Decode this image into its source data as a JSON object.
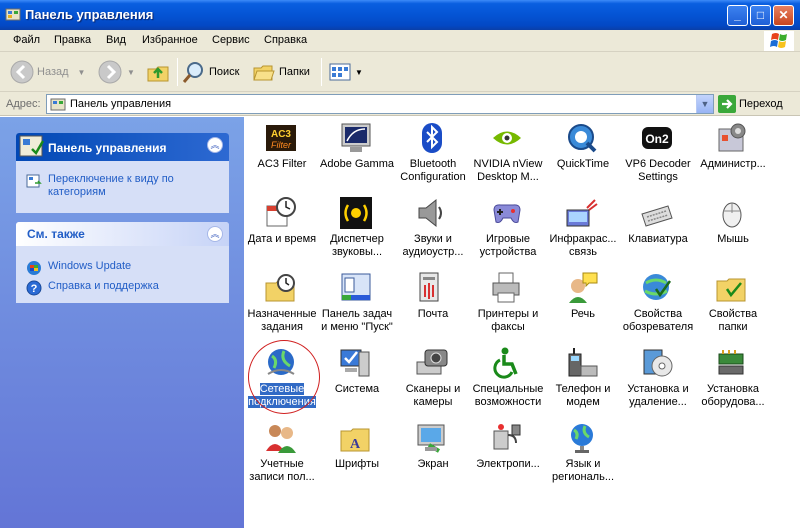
{
  "window": {
    "title": "Панель управления"
  },
  "menu": [
    "Файл",
    "Правка",
    "Вид",
    "Избранное",
    "Сервис",
    "Справка"
  ],
  "toolbar": {
    "back": "Назад",
    "search": "Поиск",
    "folders": "Папки"
  },
  "address": {
    "label": "Адрес:",
    "value": "Панель управления",
    "go": "Переход"
  },
  "sidebar": {
    "panel_title": "Панель управления",
    "switch_view": "Переключение к виду по категориям",
    "see_also_title": "См. также",
    "see_also": [
      "Windows Update",
      "Справка и поддержка"
    ]
  },
  "icons": [
    "AC3 Filter",
    "Adobe Gamma",
    "Bluetooth Configuration",
    "NVIDIA nView Desktop M...",
    "QuickTime",
    "VP6 Decoder Settings",
    "Администр...",
    "Дата и время",
    "Диспетчер звуковы...",
    "Звуки и аудиоустр...",
    "Игровые устройства",
    "Инфракрас... связь",
    "Клавиатура",
    "Мышь",
    "Назначенные задания",
    "Панель задач и меню \"Пуск\"",
    "Почта",
    "Принтеры и факсы",
    "Речь",
    "Свойства обозревателя",
    "Свойства папки",
    "Сетевые подключения",
    "Система",
    "Сканеры и камеры",
    "Специальные возможности",
    "Телефон и модем",
    "Установка и удаление...",
    "Установка оборудова...",
    "Учетные записи пол...",
    "Шрифты",
    "Экран",
    "Электропи...",
    "Язык и региональ..."
  ],
  "icon_art": {
    "ac3": "AC3",
    "vp6": "On2"
  }
}
